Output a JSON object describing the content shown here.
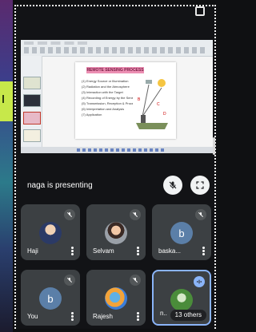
{
  "presenting": {
    "label": "naga is presenting"
  },
  "slide": {
    "title": "REMOTE SENSING PROCESS",
    "lines": [
      "(1) Energy Source or Illumination",
      "(2) Radiation and the Atmosphere",
      "(3) Interaction with the Target",
      "(4) Recording of Energy by the Sensor",
      "(5) Transmission, Reception & Processing",
      "(6) Interpretation and Analysis",
      "(7) Application"
    ]
  },
  "controls": {
    "mic_icon": "mic-off-icon",
    "fullscreen_icon": "fullscreen-icon"
  },
  "participants": [
    {
      "name": "Haji",
      "avatar": "photo",
      "muted": true
    },
    {
      "name": "Selvam",
      "avatar": "photo",
      "muted": true
    },
    {
      "name": "baska...",
      "avatar_letter": "b",
      "muted": true
    },
    {
      "name": "You",
      "avatar_letter": "b",
      "muted": true
    },
    {
      "name": "Rajesh",
      "avatar": "photo",
      "muted": true
    },
    {
      "name": "n..",
      "others_label": "13 others",
      "speaking": true
    }
  ],
  "colors": {
    "tile_bg": "#3c4043",
    "active_border": "#8ab4f8",
    "left_accent": "#c7e84a"
  }
}
